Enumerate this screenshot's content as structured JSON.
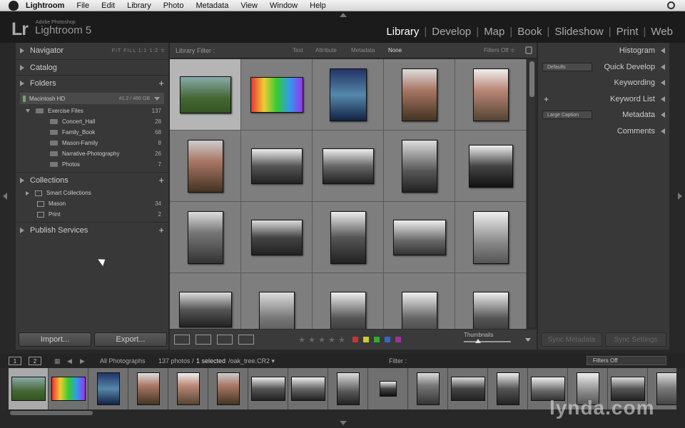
{
  "menubar": {
    "app": "Lightroom",
    "items": [
      "File",
      "Edit",
      "Library",
      "Photo",
      "Metadata",
      "View",
      "Window",
      "Help"
    ]
  },
  "identity": {
    "logo": "Lr",
    "vendor": "Adobe Photoshop",
    "product": "Lightroom 5"
  },
  "modules": [
    "Library",
    "Develop",
    "Map",
    "Book",
    "Slideshow",
    "Print",
    "Web"
  ],
  "active_module": "Library",
  "left_panel": {
    "navigator": "Navigator",
    "navigator_opts": "FIT  FILL  1:1  1:2 ≑",
    "catalog": "Catalog",
    "folders": "Folders",
    "volume": {
      "name": "Macintosh HD",
      "capacity": "#1.2 / 466 GB"
    },
    "folder_root": {
      "name": "Exercise Files",
      "count": "137"
    },
    "subfolders": [
      {
        "name": "Concert_Hall",
        "count": "28"
      },
      {
        "name": "Family_Book",
        "count": "68"
      },
      {
        "name": "Mason-Family",
        "count": "8"
      },
      {
        "name": "Narrative-Photography",
        "count": "26"
      },
      {
        "name": "Photos",
        "count": "7"
      }
    ],
    "collections": "Collections",
    "smart_collections": "Smart Collections",
    "collection_items": [
      {
        "name": "Mason",
        "count": "34"
      },
      {
        "name": "Print",
        "count": "2"
      }
    ],
    "publish_services": "Publish Services",
    "import": "Import...",
    "export": "Export..."
  },
  "filter_bar": {
    "label": "Library Filter :",
    "options": [
      "Text",
      "Attribute",
      "Metadata",
      "None"
    ],
    "status": "Filters Off ≑"
  },
  "toolbar": {
    "thumbnails_label": "Thumbnails",
    "thumb_size_fraction": 0.3,
    "color_labels": [
      "#c33",
      "#cc3",
      "#3a3",
      "#36c",
      "#939"
    ]
  },
  "right_panel": {
    "histogram": "Histogram",
    "quick_develop": "Quick Develop",
    "qd_preset": "Defaults",
    "keywording": "Keywording",
    "keyword_list": "Keyword List",
    "metadata": "Metadata",
    "metadata_preset": "Large Caption",
    "comments": "Comments",
    "sync_metadata": "Sync Metadata",
    "sync_settings": "Sync Settings"
  },
  "filmstrip_bar": {
    "page1": "1",
    "page2": "2",
    "source": "All Photographs",
    "count": "137 photos /",
    "selected": "1 selected",
    "file": "/oak_tree.CR2 ▾",
    "filter_label": "Filter :",
    "filters_off": "Filters Off"
  },
  "watermark": "lynda.com"
}
